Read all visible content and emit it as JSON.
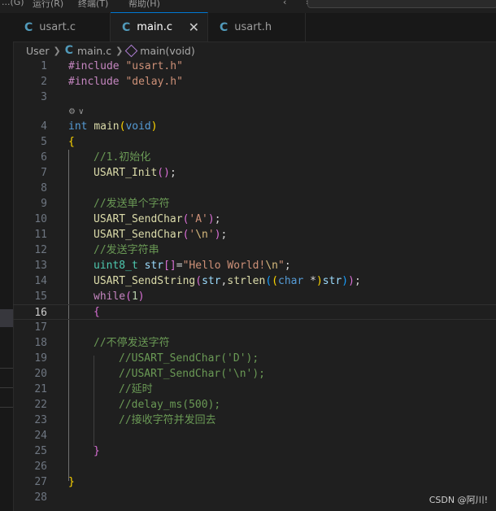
{
  "menubar": {
    "items": [
      "...(G)",
      "运行(R)",
      "终端(T)",
      "帮助(H)"
    ],
    "nav_arrows": "‹ ›"
  },
  "tabs": [
    {
      "label": "usart.c",
      "icon": "C",
      "active": false
    },
    {
      "label": "main.c",
      "icon": "C",
      "active": true,
      "close": "✕"
    },
    {
      "label": "usart.h",
      "icon": "C",
      "active": false
    }
  ],
  "breadcrumb": {
    "folder": "User",
    "file": "main.c",
    "file_icon": "C",
    "symbol": "main(void)"
  },
  "editor": {
    "code_lens": "⚙ ∨",
    "current_line": 16,
    "lines": [
      {
        "n": "1"
      },
      {
        "n": "2"
      },
      {
        "n": "3"
      },
      {
        "n": "4"
      },
      {
        "n": "5"
      },
      {
        "n": "6"
      },
      {
        "n": "7"
      },
      {
        "n": "8"
      },
      {
        "n": "9"
      },
      {
        "n": "10"
      },
      {
        "n": "11"
      },
      {
        "n": "12"
      },
      {
        "n": "13"
      },
      {
        "n": "14"
      },
      {
        "n": "15"
      },
      {
        "n": "16"
      },
      {
        "n": "17"
      },
      {
        "n": "18"
      },
      {
        "n": "19"
      },
      {
        "n": "20"
      },
      {
        "n": "21"
      },
      {
        "n": "22"
      },
      {
        "n": "23"
      },
      {
        "n": "24"
      },
      {
        "n": "25"
      },
      {
        "n": "26"
      },
      {
        "n": "27"
      },
      {
        "n": "28"
      }
    ],
    "tokens": {
      "l1": [
        "#include",
        " ",
        "\"usart.h\""
      ],
      "l2": [
        "#include",
        " ",
        "\"delay.h\""
      ],
      "l4": [
        "int",
        " ",
        "main",
        "(",
        "void",
        ")"
      ],
      "l5": [
        "{"
      ],
      "l6": [
        "//1.初始化"
      ],
      "l7": [
        "USART_Init",
        "(",
        ")",
        ";"
      ],
      "l9": [
        "//发送单个字符"
      ],
      "l10": [
        "USART_SendChar",
        "(",
        "'A'",
        ")",
        ";"
      ],
      "l11": [
        "USART_SendChar",
        "(",
        "'",
        "\\n",
        "'",
        ")",
        ";"
      ],
      "l12": [
        "//发送字符串"
      ],
      "l13": [
        "uint8_t",
        " ",
        "str",
        "[]",
        "=",
        "\"Hello World!",
        "\\n",
        "\"",
        ";"
      ],
      "l14": [
        "USART_SendString",
        "(",
        "str",
        ",",
        "strlen",
        "(",
        "(",
        "char",
        " *",
        ")",
        "str",
        ")",
        ")",
        ";"
      ],
      "l15": [
        "while",
        "(",
        "1",
        ")"
      ],
      "l16": [
        "{"
      ],
      "l18": [
        "//不停发送字符"
      ],
      "l19": [
        "//USART_SendChar('D');"
      ],
      "l20": [
        "//USART_SendChar('\\n');"
      ],
      "l21": [
        "//延时"
      ],
      "l22": [
        "//delay_ms(500);"
      ],
      "l23": [
        "//接收字符并发回去"
      ],
      "l25": [
        "}"
      ],
      "l27": [
        "}"
      ]
    }
  },
  "watermark": "CSDN @阿川!",
  "colors": {
    "background": "#1f1f1f",
    "accent": "#0078d4",
    "c_icon": "#519aba"
  }
}
